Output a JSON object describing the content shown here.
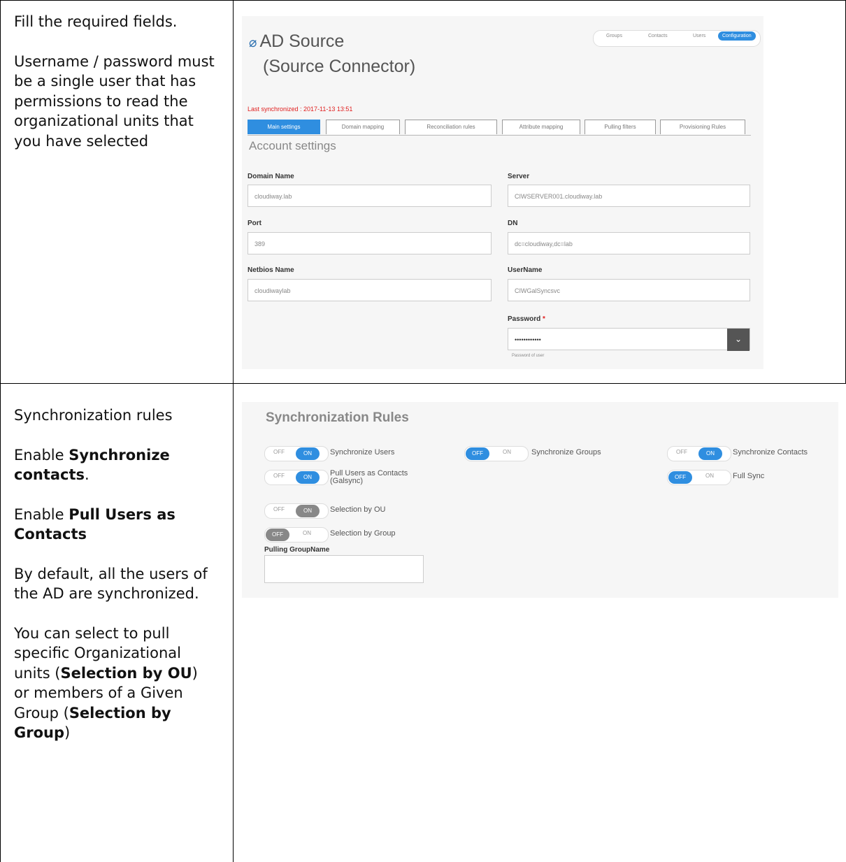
{
  "row1": {
    "paragraphs": [
      "Fill the required fields.",
      "Username / password must be a single user that has permissions to read the organizational units that you have selected"
    ]
  },
  "row2": {
    "p1": "Synchronization rules",
    "p2_pre": "Enable ",
    "p2_bold": "Synchronize contacts",
    "p2_post": ".",
    "p3_pre": "Enable ",
    "p3_bold": "Pull Users as Contacts",
    "p4": "By default, all the users of the AD are synchronized.",
    "p5_a": "You can select to pull specific Organizational units (",
    "p5_bold1": "Selection by OU",
    "p5_b": ") or members of a Given Group (",
    "p5_bold2": "Selection by Group",
    "p5_c": ")"
  },
  "shot1": {
    "title": "AD Source",
    "subtitle": "(Source Connector)",
    "nav": [
      "Groups",
      "Contacts",
      "Users",
      "Configuration"
    ],
    "last_sync": "Last synchronized : 2017-11-13 13:51",
    "tabs": [
      "Main settings",
      "Domain mapping",
      "Reconciliation rules",
      "Attribute mapping",
      "Pulling filters",
      "Provisioning Rules"
    ],
    "section_title": "Account settings",
    "fields": {
      "domain_name": {
        "label": "Domain Name",
        "value": "cloudiway.lab"
      },
      "server": {
        "label": "Server",
        "value": "CIWSERVER001.cloudiway.lab"
      },
      "port": {
        "label": "Port",
        "value": "389"
      },
      "dn": {
        "label": "DN",
        "value": "dc=cloudiway,dc=lab"
      },
      "netbios": {
        "label": "Netbios Name",
        "value": "cloudiwaylab"
      },
      "username": {
        "label": "UserName",
        "value": "CIWGalSyncsvc"
      },
      "password": {
        "label": "Password",
        "value": "••••••••••••",
        "hint": "Password of user"
      }
    }
  },
  "shot2": {
    "title": "Synchronization Rules",
    "off": "OFF",
    "on": "ON",
    "toggles": [
      {
        "label": "Synchronize Users",
        "state": "ON"
      },
      {
        "label": "Synchronize Groups",
        "state": "OFF"
      },
      {
        "label": "Synchronize Contacts",
        "state": "ON"
      },
      {
        "label": "Pull Users as Contacts",
        "label2": "(Galsync)",
        "state": "ON"
      },
      {
        "label": "Full Sync",
        "state": "OFF"
      },
      {
        "label": "Selection by OU",
        "state": "ON-disabled"
      },
      {
        "label": "Selection by Group",
        "state": "OFF-disabled"
      }
    ],
    "pulling_group_label": "Pulling GroupName",
    "pulling_group_value": ""
  },
  "colors": {
    "accent": "#2f8ee0",
    "error": "#e02020"
  }
}
